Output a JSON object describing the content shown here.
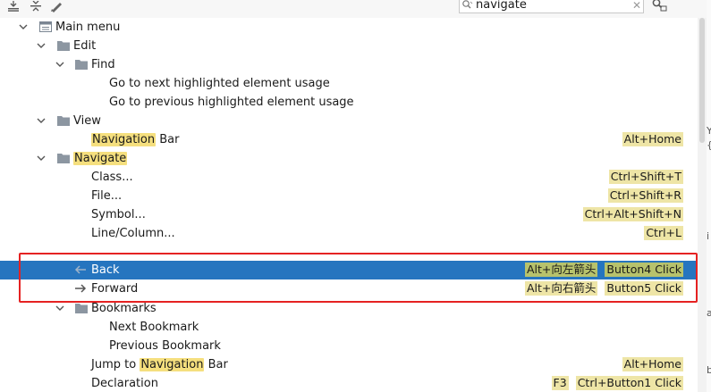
{
  "search": {
    "query": "navigate"
  },
  "tree": {
    "main_menu": "Main menu",
    "edit": "Edit",
    "find": "Find",
    "next_highlight": "Go to next highlighted element usage",
    "prev_highlight": "Go to previous highlighted element usage",
    "view": "View",
    "nav_bar_hl": "Navigation",
    "nav_bar_rest": " Bar",
    "nav_bar_shortcut": "Alt+Home",
    "navigate": "Navigate",
    "class": {
      "label": "Class...",
      "shortcut": "Ctrl+Shift+T"
    },
    "file": {
      "label": "File...",
      "shortcut": "Ctrl+Shift+R"
    },
    "symbol": {
      "label": "Symbol...",
      "shortcut": "Ctrl+Alt+Shift+N"
    },
    "line_column": {
      "label": "Line/Column...",
      "shortcut": "Ctrl+L"
    },
    "back": {
      "label": "Back",
      "shortcut1": "Alt+向左箭头",
      "shortcut2": "Button4 Click"
    },
    "forward": {
      "label": "Forward",
      "shortcut1": "Alt+向右箭头",
      "shortcut2": "Button5 Click"
    },
    "bookmarks": "Bookmarks",
    "next_bookmark": "Next Bookmark",
    "prev_bookmark": "Previous Bookmark",
    "jump_pre": "Jump to ",
    "jump_hl": "Navigation",
    "jump_post": " Bar",
    "jump_shortcut": "Alt+Home",
    "declaration": {
      "label": "Declaration",
      "shortcut1": "F3",
      "shortcut2": "Ctrl+Button1 Click"
    }
  },
  "edge_glyphs": {
    "a": "Y",
    "b": "{",
    "c": "i",
    "d": "a",
    "e": "b"
  },
  "colors": {
    "selection": "#2675bf",
    "highlight": "#f5df7e",
    "annotation": "#e52222"
  }
}
